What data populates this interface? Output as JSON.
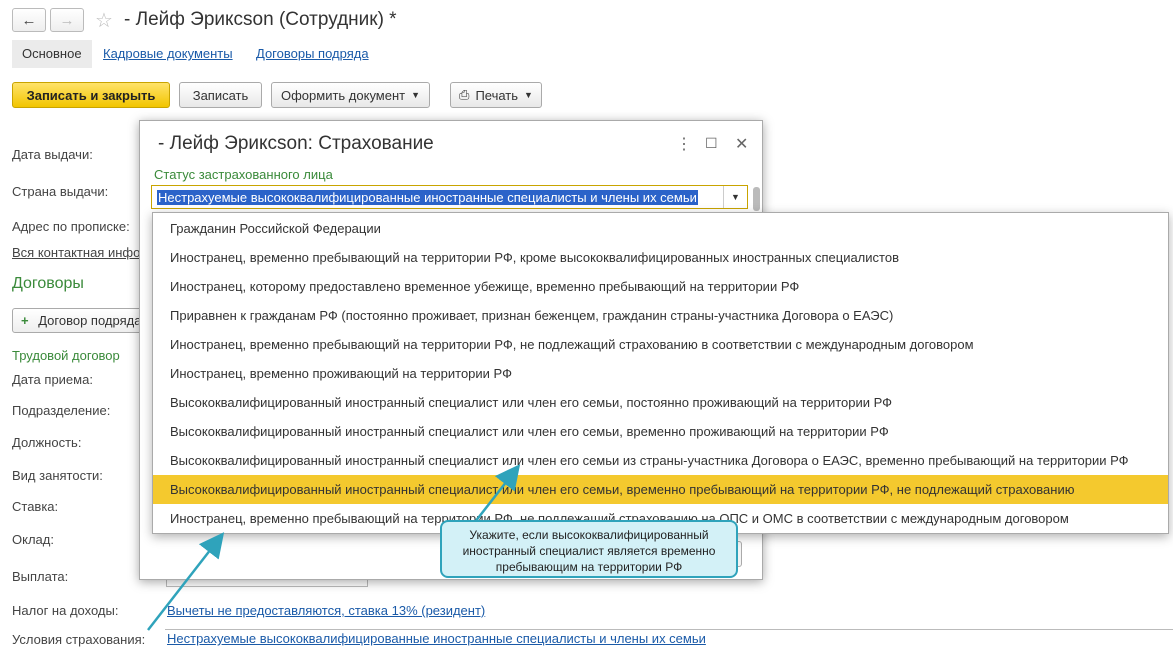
{
  "window": {
    "title": "- Лейф Эриксson (Сотрудник) *",
    "back_icon": "arrow-left-icon",
    "forward_icon": "arrow-right-icon",
    "favorite_icon": "star-icon"
  },
  "tabs": [
    {
      "label": "Основное"
    },
    {
      "label": "Кадровые документы"
    },
    {
      "label": "Договоры подряда"
    }
  ],
  "toolbar": {
    "save_close": "Записать и закрыть",
    "save": "Записать",
    "make_doc": "Оформить документ",
    "print": "Печать"
  },
  "form": {
    "issue_date": "Дата выдачи:",
    "issue_country": "Страна выдачи:",
    "address": "Адрес по прописке:",
    "all_contacts": "Вся контактная инфо",
    "contracts_header": "Договоры",
    "add_contract": "Договор подряда",
    "employment_contract": "Трудовой договор",
    "hire_date": "Дата приема:",
    "department": "Подразделение:",
    "position": "Должность:",
    "employment_type": "Вид занятости:",
    "rate": "Ставка:",
    "salary": "Оклад:",
    "payment": "Выплата:",
    "income_tax": "Налог на доходы:",
    "income_tax_value": "Вычеты не предоставляются, ставка 13% (резидент)",
    "insurance_conditions": "Условия страхования:",
    "insurance_value": "Нестрахуемые высококвалифицированные иностранные специалисты и члены их семьи"
  },
  "dialog": {
    "title": "- Лейф Эриксson: Страхование",
    "field_caption": "Статус застрахованного лица",
    "field_value": "Нестрахуемые высококвалифицированные иностранные специалисты и члены их семьи"
  },
  "dropdown": {
    "items": [
      "Гражданин Российской Федерации",
      "Иностранец, временно пребывающий на территории РФ, кроме высококвалифицированных иностранных специалистов",
      "Иностранец, которому предоставлено временное убежище, временно пребывающий на территории РФ",
      "Приравнен к гражданам РФ (постоянно проживает, признан беженцем, гражданин страны-участника Договора о ЕАЭС)",
      "Иностранец, временно пребывающий на территории РФ, не подлежащий страхованию в соответствии с международным договором",
      "Иностранец, временно проживающий на территории РФ",
      "Высококвалифицированный иностранный специалист или член его семьи, постоянно проживающий на территории РФ",
      "Высококвалифицированный иностранный специалист или член его семьи, временно проживающий на территории РФ",
      "Высококвалифицированный иностранный специалист или член его семьи из страны-участника Договора о ЕАЭС, временно пребывающий на территории РФ",
      "Высококвалифицированный иностранный специалист или член его семьи, временно пребывающий на территории РФ, не подлежащий страхованию",
      "Иностранец, временно пребывающий на территории РФ, не подлежащий страхованию на ОПС и ОМС в соответствии с международным договором"
    ],
    "selected_index": 9
  },
  "callout": {
    "text": "Укажите, если высококвалифицированный иностранный специалист является временно пребывающим на территории РФ"
  },
  "colors": {
    "accent_yellow": "#f4c92e",
    "link_blue": "#1a5aa8",
    "green": "#3a8a3a",
    "callout_bg": "#d3f1f7",
    "callout_border": "#2fa3bb"
  }
}
